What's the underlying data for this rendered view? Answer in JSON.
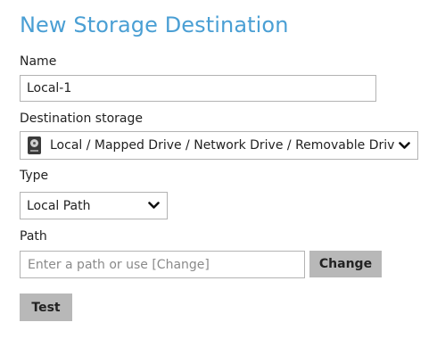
{
  "page": {
    "title": "New Storage Destination"
  },
  "form": {
    "name_label": "Name",
    "name_value": "Local-1",
    "destination_label": "Destination storage",
    "destination_value": "Local / Mapped Drive / Network Drive / Removable Drive",
    "destination_icon": "hard-drive-icon",
    "type_label": "Type",
    "type_value": "Local Path",
    "path_label": "Path",
    "path_placeholder": "Enter a path or use [Change]",
    "path_value": ""
  },
  "buttons": {
    "change_label": "Change",
    "test_label": "Test"
  },
  "colors": {
    "title": "#4a9fd4",
    "button_bg": "#b8b8b8",
    "field_border": "#b3b3b3"
  }
}
